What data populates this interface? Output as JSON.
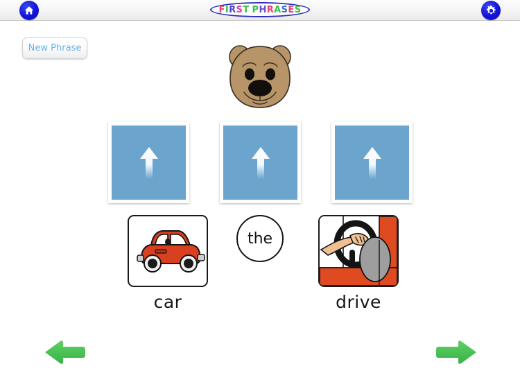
{
  "header": {
    "home_icon": "home-icon",
    "settings_icon": "gear-icon",
    "title": "FIRST PHRASES",
    "title_letters": [
      {
        "ch": "F",
        "color": "#e8436b"
      },
      {
        "ch": "I",
        "color": "#3fbf4a"
      },
      {
        "ch": "R",
        "color": "#4b46d2"
      },
      {
        "ch": "S",
        "color": "#e03fb0"
      },
      {
        "ch": "T",
        "color": "#3fbf4a"
      },
      {
        "ch": " ",
        "color": "#000000"
      },
      {
        "ch": "P",
        "color": "#3fbf4a"
      },
      {
        "ch": "H",
        "color": "#6b4bd2"
      },
      {
        "ch": "R",
        "color": "#e8436b"
      },
      {
        "ch": "A",
        "color": "#3fbf4a"
      },
      {
        "ch": "S",
        "color": "#3f6bd2"
      },
      {
        "ch": "E",
        "color": "#e03f6b"
      },
      {
        "ch": "S",
        "color": "#3fbf4a"
      }
    ],
    "title_border_color": "#2d2dc4",
    "button_color": "#1313d8"
  },
  "toolbar": {
    "new_phrase_label": "New Phrase",
    "new_phrase_text_color": "#63b6e8"
  },
  "avatar": {
    "name": "bear-avatar",
    "fur_color": "#b79568",
    "outline_color": "#3d3327"
  },
  "sentence_slots": [
    {
      "name": "slot-1",
      "state": "empty",
      "icon": "arrow-up-icon"
    },
    {
      "name": "slot-2",
      "state": "empty",
      "icon": "arrow-up-icon"
    },
    {
      "name": "slot-3",
      "state": "empty",
      "icon": "arrow-up-icon"
    }
  ],
  "slot_color": "#6ba5ce",
  "choices": [
    {
      "name": "choice-car",
      "type": "picture",
      "label": "car",
      "image": "red-car-icon"
    },
    {
      "name": "choice-the",
      "type": "word",
      "label": "the",
      "image": ""
    },
    {
      "name": "choice-drive",
      "type": "picture",
      "label": "drive",
      "image": "hands-on-steering-wheel-icon"
    }
  ],
  "navigation": {
    "previous_label": "previous",
    "next_label": "next",
    "arrow_color": "#49c352"
  }
}
